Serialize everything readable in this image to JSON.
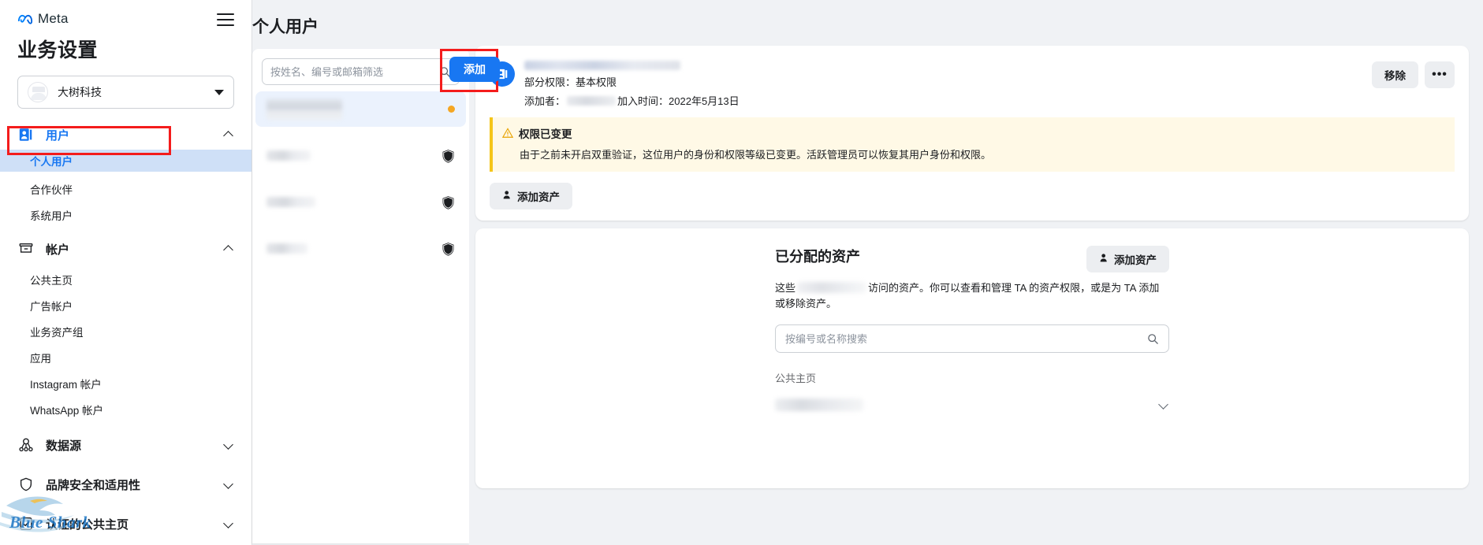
{
  "brand": {
    "name": "Meta",
    "logo_icon": "meta-infinity-logo",
    "menu_icon": "hamburger-menu-icon"
  },
  "sidebar": {
    "title": "业务设置",
    "business": {
      "name": "大树科技",
      "avatar_icon": "business-avatar-icon",
      "caret_icon": "caret-down-icon"
    },
    "groups": [
      {
        "label": "用户",
        "icon": "user-card-icon",
        "expanded": true,
        "active": true,
        "chevron": "chevron-up-icon",
        "items": [
          {
            "label": "个人用户",
            "selected": true
          },
          {
            "label": "合作伙伴",
            "selected": false
          },
          {
            "label": "系统用户",
            "selected": false
          }
        ]
      },
      {
        "label": "帐户",
        "icon": "archive-box-icon",
        "expanded": true,
        "active": false,
        "chevron": "chevron-up-icon",
        "items": [
          {
            "label": "公共主页",
            "selected": false
          },
          {
            "label": "广告帐户",
            "selected": false
          },
          {
            "label": "业务资产组",
            "selected": false
          },
          {
            "label": "应用",
            "selected": false
          },
          {
            "label": "Instagram 帐户",
            "selected": false
          },
          {
            "label": "WhatsApp 帐户",
            "selected": false
          }
        ]
      },
      {
        "label": "数据源",
        "icon": "data-source-nodes-icon",
        "expanded": false,
        "active": false,
        "chevron": "chevron-down-icon",
        "items": []
      },
      {
        "label": "品牌安全和适用性",
        "icon": "shield-icon",
        "expanded": false,
        "active": false,
        "chevron": "chevron-down-icon",
        "items": []
      },
      {
        "label": "认证的公共主页",
        "icon": "verified-page-icon",
        "expanded": false,
        "active": false,
        "chevron": "chevron-down-icon",
        "items": []
      }
    ],
    "watermark": {
      "text": "Blue Shark",
      "icon": "blue-shark-wave-logo"
    }
  },
  "middle": {
    "page_title": "个人用户",
    "search": {
      "placeholder": "按姓名、编号或邮箱筛选",
      "value": "",
      "icon": "search-icon"
    },
    "add_button": {
      "label": "添加"
    },
    "users": [
      {
        "name_redacted": true,
        "selected": true,
        "badge": "orange-dot",
        "badge_icon": "status-dot-icon"
      },
      {
        "name_redacted": true,
        "selected": false,
        "badge": "shield",
        "badge_icon": "shield-check-icon"
      },
      {
        "name_redacted": true,
        "selected": false,
        "badge": "shield",
        "badge_icon": "shield-check-icon"
      },
      {
        "name_redacted": true,
        "selected": false,
        "badge": "shield",
        "badge_icon": "shield-check-icon"
      }
    ]
  },
  "detail": {
    "avatar_icon": "user-profile-avatar-icon",
    "name_redacted": true,
    "permission_line": "部分权限：基本权限",
    "added_by_label": "添加者：",
    "joined_label": "加入时间：",
    "joined_date": "2022年5月13日",
    "actions": {
      "remove_label": "移除",
      "more_label": "•••",
      "more_icon": "ellipsis-icon"
    },
    "warning": {
      "icon": "warning-triangle-icon",
      "title": "权限已变更",
      "body": "由于之前未开启双重验证，这位用户的身份和权限等级已变更。活跃管理员可以恢复其用户身份和权限。"
    },
    "add_asset_button": {
      "label": "添加资产",
      "icon": "add-person-icon"
    }
  },
  "assets": {
    "title": "已分配的资产",
    "add_asset_button": {
      "label": "添加资产",
      "icon": "add-person-icon"
    },
    "description_prefix": "这些",
    "description_suffix": "访问的资产。你可以查看和管理 TA 的资产权限，或是为 TA 添加或移除资产。",
    "search": {
      "placeholder": "按编号或名称搜索",
      "value": "",
      "icon": "search-icon"
    },
    "group_label": "公共主页",
    "rows": [
      {
        "name_redacted": true,
        "chevron_icon": "chevron-down-icon"
      }
    ]
  },
  "colors": {
    "accent_blue": "#1877f2",
    "selected_nav_bg": "#cfe0f7",
    "warning_bg": "#fff9e6",
    "warning_border": "#f5c518",
    "status_orange": "#f5a623",
    "annotation_red": "#f41c1c",
    "page_bg": "#f0f2f5"
  }
}
